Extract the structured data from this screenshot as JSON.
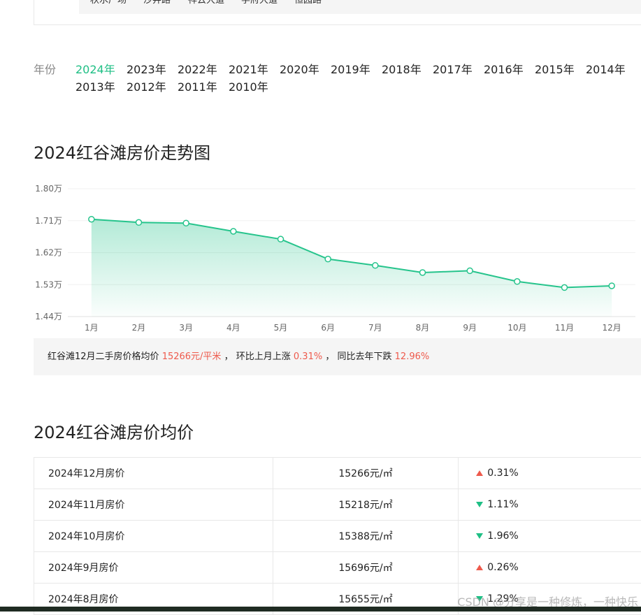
{
  "filter": {
    "roads": [
      "秋水广场",
      "沙井路",
      "祥云大道",
      "学府大道",
      "恒园路"
    ]
  },
  "year_selector": {
    "label": "年份",
    "years": [
      "2024年",
      "2023年",
      "2022年",
      "2021年",
      "2020年",
      "2019年",
      "2018年",
      "2017年",
      "2016年",
      "2015年",
      "2014年",
      "2013年",
      "2012年",
      "2011年",
      "2010年"
    ],
    "active": "2024年"
  },
  "trend": {
    "title": "2024红谷滩房价走势图"
  },
  "chart_data": {
    "type": "area",
    "categories": [
      "1月",
      "2月",
      "3月",
      "4月",
      "5月",
      "6月",
      "7月",
      "8月",
      "9月",
      "10月",
      "11月",
      "12月"
    ],
    "values": [
      17140,
      17050,
      17030,
      16800,
      16580,
      16020,
      15840,
      15640,
      15690,
      15388,
      15218,
      15266
    ],
    "ylim": [
      14400,
      18000
    ],
    "yticks": [
      "1.44万",
      "1.53万",
      "1.62万",
      "1.71万",
      "1.80万"
    ],
    "grid": true,
    "line_color": "#26c48c",
    "fill_color": "#26c48c"
  },
  "summary": {
    "prefix": "红谷滩12月二手房价格均价",
    "price": "15266元/平米",
    "sep1": "，",
    "mom_text": "环比上月上涨",
    "mom_value": "0.31%",
    "sep2": "，",
    "yoy_text": "同比去年下跌",
    "yoy_value": "12.96%"
  },
  "avg": {
    "title": "2024红谷滩房价均价",
    "rows": [
      {
        "period": "2024年12月房价",
        "price": "15266元/㎡",
        "direction": "up",
        "change": "0.31%"
      },
      {
        "period": "2024年11月房价",
        "price": "15218元/㎡",
        "direction": "down",
        "change": "1.11%"
      },
      {
        "period": "2024年10月房价",
        "price": "15388元/㎡",
        "direction": "down",
        "change": "1.96%"
      },
      {
        "period": "2024年9月房价",
        "price": "15696元/㎡",
        "direction": "up",
        "change": "0.26%"
      },
      {
        "period": "2024年8月房价",
        "price": "15655元/㎡",
        "direction": "down",
        "change": "1.29%"
      }
    ]
  },
  "colors": {
    "accent": "#1fbf85",
    "up": "#ee5a4c",
    "down": "#1fbf85"
  },
  "watermark": "CSDN @分享是一种修炼，一种快乐"
}
